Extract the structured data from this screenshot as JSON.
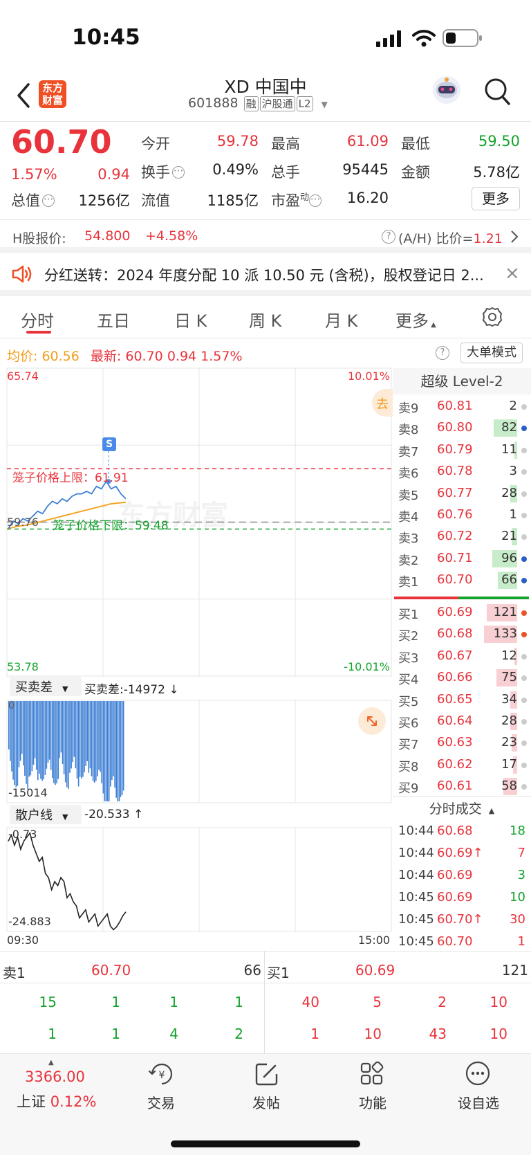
{
  "status": {
    "time": "10:45"
  },
  "header": {
    "brand": "东方\n财富",
    "title": "XD 中国中",
    "code": "601888",
    "tags": [
      "融",
      "沪股通",
      "L2"
    ]
  },
  "quote": {
    "price": "60.70",
    "change_pct": "1.57%",
    "change": "0.94",
    "fields": [
      {
        "label": "今开",
        "value": "59.78",
        "color": "red"
      },
      {
        "label": "最高",
        "value": "61.09",
        "color": "red"
      },
      {
        "label": "最低",
        "value": "59.50",
        "color": "green"
      },
      {
        "label": "换手",
        "value": "0.49%",
        "color": "dark"
      },
      {
        "label": "总手",
        "value": "95445",
        "color": "dark"
      },
      {
        "label": "金额",
        "value": "5.78亿",
        "color": "dark"
      },
      {
        "label": "总值",
        "value": "1256亿",
        "color": "dark"
      },
      {
        "label": "流值",
        "value": "1185亿",
        "color": "dark"
      },
      {
        "label": "市盈",
        "sup": "动",
        "value": "16.20",
        "color": "dark"
      }
    ],
    "more_btn": "更多"
  },
  "hshare": {
    "label": "H股报价:",
    "price": "54.800",
    "change": "+4.58%",
    "ah_label": "(A/H) 比价=",
    "ah_value": "1.21"
  },
  "notice": {
    "text": "分红送转：2024 年度分配 10 派 10.50 元 (含税)，股权登记日 2..."
  },
  "tabs": [
    "分时",
    "五日",
    "日 K",
    "周 K",
    "月 K",
    "更多"
  ],
  "chart_info": {
    "avg_label": "均价:",
    "avg": "60.56",
    "latest_label": "最新:",
    "latest": "60.70",
    "chg": "0.94",
    "pct": "1.57%",
    "mode_btn": "大单模式"
  },
  "chart_data": {
    "type": "line",
    "y_max": "65.74",
    "y_min": "53.78",
    "pct_max": "10.01%",
    "pct_min": "-10.01%",
    "prev_close": "59.76",
    "cage_upper_label": "笼子价格上限：61.91",
    "cage_lower_label": "笼子价格下限：59.48",
    "watermark": "东方财富",
    "x_start": "09:30",
    "x_end": "15:00",
    "price": [
      59.5,
      59.8,
      59.7,
      59.9,
      59.8,
      60.0,
      60.2,
      60.1,
      60.4,
      60.6,
      60.5,
      60.7,
      60.6,
      60.8,
      60.9,
      60.9,
      61.0,
      60.9,
      61.2,
      61.1,
      61.4,
      61.1,
      61.2,
      60.9,
      60.7
    ],
    "avg": [
      59.5,
      59.55,
      59.6,
      59.62,
      59.65,
      59.7,
      59.75,
      59.8,
      59.85,
      59.9,
      59.95,
      60.0,
      60.05,
      60.1,
      60.15,
      60.2,
      60.25,
      60.3,
      60.35,
      60.4,
      60.45,
      60.5,
      60.52,
      60.54,
      60.56
    ],
    "sub1": {
      "selector": "买卖差",
      "label": "买卖差:-14972 ↓",
      "top": "0",
      "bottom": "-15014"
    },
    "sub2": {
      "selector": "散户线",
      "label": "-20.533 ↑",
      "top": "-0.73",
      "bottom": "-24.883",
      "values": [
        -3,
        -1.5,
        -4,
        -2,
        -5,
        -3,
        -2,
        -1,
        -4,
        -6,
        -8,
        -7,
        -11,
        -12,
        -15,
        -13,
        -14,
        -12,
        -13,
        -17,
        -16,
        -18,
        -19,
        -22,
        -21,
        -20,
        -23,
        -22,
        -21,
        -24,
        -23,
        -22,
        -21,
        -24,
        -24.9,
        -24.2,
        -23,
        -21.5,
        -20.5
      ]
    }
  },
  "orderbook": {
    "title": "超级 Level-2",
    "asks": [
      {
        "label": "卖9",
        "price": "60.81",
        "vol": "2",
        "bar": 0,
        "dot": "#ccc"
      },
      {
        "label": "卖8",
        "price": "60.80",
        "vol": "82",
        "bar": 34,
        "dot": "#2a5fc4"
      },
      {
        "label": "卖7",
        "price": "60.79",
        "vol": "11",
        "bar": 4,
        "dot": "#ccc"
      },
      {
        "label": "卖6",
        "price": "60.78",
        "vol": "3",
        "bar": 0,
        "dot": "#ccc"
      },
      {
        "label": "卖5",
        "price": "60.77",
        "vol": "28",
        "bar": 10,
        "dot": "#ccc"
      },
      {
        "label": "卖4",
        "price": "60.76",
        "vol": "1",
        "bar": 0,
        "dot": "#ccc"
      },
      {
        "label": "卖3",
        "price": "60.72",
        "vol": "21",
        "bar": 8,
        "dot": "#ccc"
      },
      {
        "label": "卖2",
        "price": "60.71",
        "vol": "96",
        "bar": 36,
        "dot": "#2a5fc4"
      },
      {
        "label": "卖1",
        "price": "60.70",
        "vol": "66",
        "bar": 28,
        "dot": "#2a5fc4"
      }
    ],
    "bids": [
      {
        "label": "买1",
        "price": "60.69",
        "vol": "121",
        "bar": 44,
        "dot": "#e8542b"
      },
      {
        "label": "买2",
        "price": "60.68",
        "vol": "133",
        "bar": 48,
        "dot": "#e8542b"
      },
      {
        "label": "买3",
        "price": "60.67",
        "vol": "12",
        "bar": 4,
        "dot": "#ccc"
      },
      {
        "label": "买4",
        "price": "60.66",
        "vol": "75",
        "bar": 30,
        "dot": "#ccc"
      },
      {
        "label": "买5",
        "price": "60.65",
        "vol": "34",
        "bar": 10,
        "dot": "#ccc"
      },
      {
        "label": "买6",
        "price": "60.64",
        "vol": "28",
        "bar": 10,
        "dot": "#ccc"
      },
      {
        "label": "买7",
        "price": "60.63",
        "vol": "23",
        "bar": 8,
        "dot": "#ccc"
      },
      {
        "label": "买8",
        "price": "60.62",
        "vol": "17",
        "bar": 6,
        "dot": "#ccc"
      },
      {
        "label": "买9",
        "price": "60.61",
        "vol": "58",
        "bar": 20,
        "dot": "#ccc"
      }
    ]
  },
  "trades": {
    "title": "分时成交",
    "rows": [
      {
        "time": "10:44",
        "price": "60.68",
        "vol": "18",
        "vc": "green"
      },
      {
        "time": "10:44",
        "price": "60.69↑",
        "vol": "7",
        "vc": "red"
      },
      {
        "time": "10:44",
        "price": "60.69",
        "vol": "3",
        "vc": "green"
      },
      {
        "time": "10:45",
        "price": "60.69",
        "vol": "10",
        "vc": "green"
      },
      {
        "time": "10:45",
        "price": "60.70↑",
        "vol": "30",
        "vc": "red"
      },
      {
        "time": "10:45",
        "price": "60.70",
        "vol": "1",
        "vc": "red"
      }
    ]
  },
  "bottom_queue": {
    "ask": {
      "label": "卖1",
      "price": "60.70",
      "vol": "66",
      "row1": [
        "15",
        "1",
        "1",
        "1"
      ],
      "row2": [
        "1",
        "1",
        "4",
        "2"
      ]
    },
    "bid": {
      "label": "买1",
      "price": "60.69",
      "vol": "121",
      "row1": [
        "40",
        "5",
        "2",
        "10"
      ],
      "row2": [
        "1",
        "10",
        "43",
        "10"
      ]
    }
  },
  "nav": {
    "index_value": "3366.00",
    "index_name": "上证",
    "index_pct": "0.12%",
    "items": [
      "交易",
      "发帖",
      "功能",
      "设自选"
    ]
  }
}
